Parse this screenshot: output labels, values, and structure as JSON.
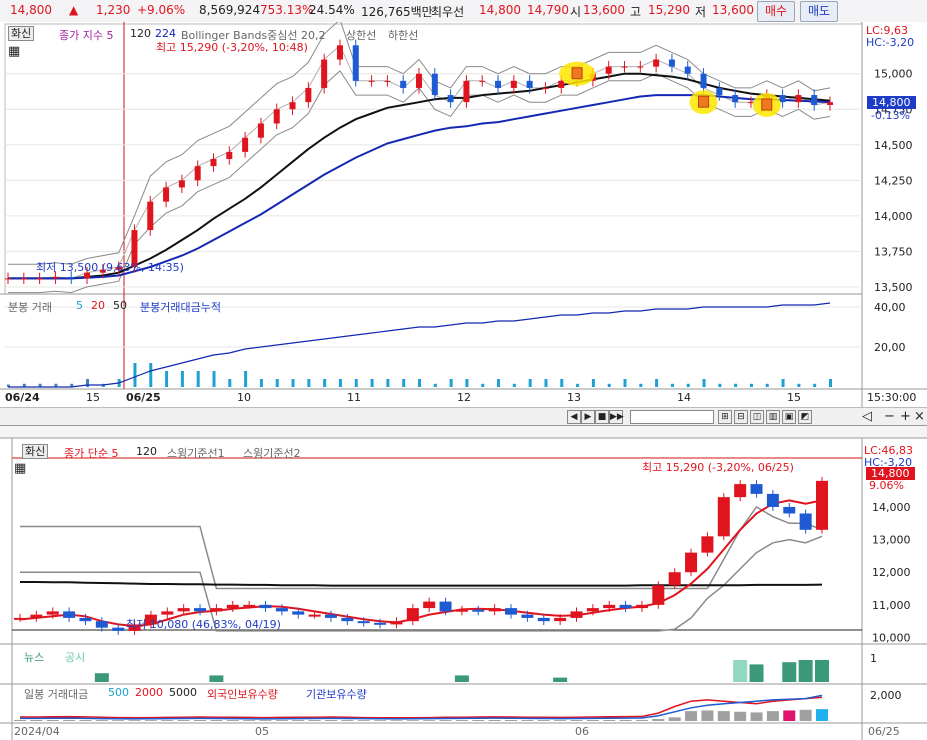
{
  "ticker": {
    "price": "14,800",
    "arrow": "▲",
    "change": "1,230",
    "change_pct": "+9.06%",
    "volume": "8,569,924",
    "vol_ratio": "753.13%",
    "turnover": "24.54%",
    "amount": "126,765백만",
    "quote_label": "최우선",
    "ask": "14,800",
    "bid": "14,790",
    "open_label": "시",
    "open": "13,600",
    "high_label": "고",
    "high": "15,290",
    "low_label": "저",
    "low": "13,600",
    "buy_label": "매수",
    "sell_label": "매도"
  },
  "top_chart": {
    "btn": "화신",
    "legend_main": "종가 지수 5",
    "legend_120": "120",
    "legend_224": "224",
    "legend_bb": "Bollinger Bands중심선 20,2",
    "legend_up": "상한선",
    "legend_down": "하한선",
    "hi_note": "최고 15,290 (-3,20%, 10:48)",
    "lo_note": "최저 13,500 (9,63%, 14:35)",
    "lc": "LC:9,63",
    "hc": "HC:-3,20",
    "price_box": "14,800",
    "price_pct": "-0.13%",
    "y_ticks": [
      "15,000",
      "14,750",
      "14,500",
      "14,250",
      "14,000",
      "13,750",
      "13,500"
    ],
    "vol_legend_a": "분봉 거래",
    "vol_legend_5": "5",
    "vol_legend_20": "20",
    "vol_legend_50": "50",
    "vol_legend_b": "분봉거래대금누적",
    "vol_ticks": [
      "40,00",
      "20,00"
    ],
    "x_labels": [
      "06/24",
      "15",
      "06/25",
      "10",
      "11",
      "12",
      "13",
      "14",
      "15",
      "15:30:00"
    ]
  },
  "bottom_chart": {
    "btn": "화신",
    "legend_main": "종가 단순 5",
    "legend_120": "120",
    "legend_sw1": "스윙기준선1",
    "legend_sw2": "스윙기준선2",
    "hi_note": "최고 15,290 (-3,20%, 06/25)",
    "lo_note": "최저 10,080 (46,83%, 04/19)",
    "lc": "LC:46,83",
    "hc": "HC:-3,20",
    "price_box": "14,800",
    "price_pct": "9.06%",
    "y_ticks": [
      "14,000",
      "13,000",
      "12,000",
      "11,000",
      "10,000"
    ],
    "news_legend_a": "뉴스",
    "news_legend_b": "공시",
    "news_tick": "1",
    "daily_legend": "일봉 거래대금",
    "daily_500": "500",
    "daily_2000": "2000",
    "daily_5000": "5000",
    "daily_foreign": "외국인보유수량",
    "daily_inst": "기관보유수량",
    "daily_tick": "2,000",
    "x_labels": [
      "2024/04",
      "05",
      "06",
      "06/25"
    ]
  },
  "colors": {
    "up": "#e0141e",
    "down": "#1e5ad2",
    "ma_black": "#111111",
    "ma_blue": "#1428b4",
    "bb_gray": "#8a8a8a",
    "highlight": "#ffe600"
  },
  "chart_data": [
    {
      "type": "candlestick",
      "title": "분봉",
      "ylim": [
        13450,
        15350
      ],
      "y_ticks": [
        15000,
        14750,
        14500,
        14250,
        14000,
        13750,
        13500
      ],
      "x_labels": [
        "06/24",
        "15",
        "06/25",
        "10",
        "11",
        "12",
        "13",
        "14",
        "15"
      ],
      "series": [
        {
          "name": "종가",
          "values": [
            13560,
            13560,
            13560,
            13570,
            13560,
            13600,
            13620,
            13640,
            13900,
            14100,
            14200,
            14250,
            14350,
            14400,
            14450,
            14550,
            14650,
            14750,
            14800,
            14900,
            15100,
            15200,
            14950,
            14950,
            14950,
            14900,
            15000,
            14850,
            14800,
            14950,
            14950,
            14900,
            14950,
            14900,
            14900,
            14950,
            14950,
            15000,
            15050,
            15050,
            15050,
            15100,
            15050,
            15000,
            14900,
            14850,
            14800,
            14800,
            14850,
            14800,
            14850,
            14780,
            14800
          ]
        },
        {
          "name": "120",
          "values": [
            13560,
            13560,
            13560,
            13560,
            13560,
            13570,
            13580,
            13600,
            13650,
            13700,
            13760,
            13830,
            13900,
            13980,
            14050,
            14120,
            14200,
            14290,
            14380,
            14470,
            14550,
            14620,
            14680,
            14720,
            14760,
            14780,
            14800,
            14820,
            14830,
            14830,
            14850,
            14860,
            14870,
            14880,
            14900,
            14920,
            14940,
            14960,
            14980,
            15000,
            15000,
            14990,
            14980,
            14960,
            14930,
            14900,
            14880,
            14860,
            14850,
            14840,
            14830,
            14820,
            14810
          ]
        },
        {
          "name": "224",
          "values": [
            13560,
            13560,
            13560,
            13560,
            13560,
            13565,
            13570,
            13580,
            13610,
            13640,
            13680,
            13720,
            13770,
            13830,
            13890,
            13950,
            14010,
            14080,
            14150,
            14220,
            14290,
            14350,
            14410,
            14460,
            14510,
            14540,
            14570,
            14600,
            14620,
            14630,
            14650,
            14660,
            14680,
            14700,
            14720,
            14740,
            14760,
            14780,
            14800,
            14820,
            14840,
            14850,
            14850,
            14850,
            14850,
            14840,
            14830,
            14820,
            14820,
            14815,
            14810,
            14805,
            14800
          ]
        }
      ]
    },
    {
      "type": "bar",
      "title": "분봉 거래",
      "ylim": [
        0,
        45
      ],
      "y_ticks": [
        40,
        20
      ],
      "series": [
        {
          "name": "분봉거래대금누적",
          "values": [
            0,
            0,
            0,
            0,
            0,
            1,
            1,
            2,
            5,
            8,
            10,
            12,
            14,
            16,
            17,
            19,
            20,
            21,
            22,
            23,
            24,
            25,
            26,
            27,
            28,
            29,
            30,
            30,
            31,
            32,
            32,
            33,
            33,
            34,
            35,
            36,
            36,
            37,
            37,
            38,
            38,
            39,
            39,
            39,
            40,
            40,
            40,
            40,
            40,
            41,
            41,
            41,
            42
          ]
        }
      ]
    },
    {
      "type": "candlestick",
      "title": "일봉",
      "ylim": [
        9800,
        15500
      ],
      "y_ticks": [
        14000,
        13000,
        12000,
        11000,
        10000
      ],
      "x_labels": [
        "2024/04",
        "05",
        "06",
        "06/25"
      ],
      "series": [
        {
          "name": "종가",
          "values": [
            10600,
            10700,
            10800,
            10600,
            10500,
            10300,
            10200,
            10400,
            10700,
            10800,
            10900,
            10800,
            10900,
            11000,
            11000,
            10900,
            10800,
            10700,
            10700,
            10600,
            10500,
            10450,
            10400,
            10500,
            10900,
            11100,
            10800,
            10850,
            10800,
            10900,
            10700,
            10600,
            10500,
            10600,
            10800,
            10900,
            11000,
            10900,
            11000,
            11600,
            12000,
            12600,
            13100,
            14300,
            14700,
            14400,
            14000,
            13800,
            13300,
            14800
          ]
        },
        {
          "name": "종가 단순 5",
          "values": [
            10550,
            10600,
            10650,
            10700,
            10650,
            10500,
            10400,
            10350,
            10400,
            10550,
            10700,
            10780,
            10820,
            10880,
            10920,
            10960,
            10940,
            10880,
            10800,
            10720,
            10640,
            10560,
            10500,
            10460,
            10560,
            10700,
            10780,
            10860,
            10880,
            10860,
            10820,
            10760,
            10700,
            10660,
            10680,
            10760,
            10840,
            10900,
            10950,
            11050,
            11300,
            11650,
            12100,
            12700,
            13300,
            13800,
            14100,
            14200,
            14100,
            14200
          ]
        },
        {
          "name": "120",
          "values": [
            11700,
            11700,
            11690,
            11690,
            11680,
            11670,
            11660,
            11650,
            11640,
            11640,
            11630,
            11630,
            11620,
            11620,
            11610,
            11610,
            11600,
            11600,
            11600,
            11590,
            11590,
            11590,
            11590,
            11590,
            11590,
            11590,
            11590,
            11590,
            11590,
            11590,
            11590,
            11590,
            11590,
            11590,
            11590,
            11590,
            11590,
            11590,
            11600,
            11600,
            11600,
            11600,
            11600,
            11600,
            11600,
            11610,
            11610,
            11610,
            11610,
            11620
          ]
        },
        {
          "name": "스윙기준선1",
          "values": [
            13400,
            13400,
            13400,
            13400,
            13400,
            13400,
            13400,
            13400,
            13400,
            13400,
            13400,
            13400,
            11500,
            11500,
            11500,
            11500,
            11500,
            11500,
            11500,
            11500,
            11500,
            11500,
            11500,
            11500,
            11500,
            11500,
            11500,
            11500,
            11500,
            11500,
            11500,
            11500,
            11500,
            11500,
            11500,
            11500,
            11500,
            11500,
            11500,
            11500,
            11500,
            11500,
            11500,
            12400,
            13300,
            14000,
            13700,
            13500,
            13500,
            13300
          ]
        },
        {
          "name": "스윙기준선2",
          "values": [
            12000,
            12000,
            12000,
            12000,
            12000,
            12000,
            12000,
            12000,
            12000,
            12000,
            12000,
            12000,
            10200,
            10200,
            10200,
            10200,
            10200,
            10200,
            10200,
            10200,
            10200,
            10200,
            10200,
            10200,
            10200,
            10200,
            10200,
            10200,
            10200,
            10200,
            10200,
            10200,
            10200,
            10200,
            10200,
            10200,
            10200,
            10200,
            10200,
            10200,
            10250,
            10600,
            11200,
            11600,
            12100,
            12600,
            12900,
            13000,
            12900,
            13100
          ]
        }
      ]
    },
    {
      "type": "bar",
      "title": "일봉 거래대금",
      "ylim": [
        0,
        2500
      ],
      "y_ticks": [
        2000
      ],
      "series": [
        {
          "name": "외국인보유수량",
          "values": [
            300,
            300,
            320,
            330,
            310,
            280,
            260,
            250,
            260,
            270,
            280,
            300,
            290,
            280,
            270,
            260,
            270,
            280,
            290,
            300,
            280,
            260,
            250,
            240,
            250,
            260,
            280,
            290,
            300,
            310,
            300,
            290,
            280,
            270,
            280,
            300,
            320,
            330,
            340,
            600,
            1100,
            1500,
            1600,
            1500,
            1400,
            1300,
            1500,
            1600,
            1700,
            1800
          ]
        },
        {
          "name": "기관보유수량",
          "values": [
            200,
            200,
            210,
            220,
            200,
            180,
            170,
            160,
            170,
            180,
            190,
            200,
            190,
            180,
            170,
            160,
            170,
            180,
            190,
            200,
            190,
            180,
            170,
            160,
            170,
            180,
            190,
            200,
            210,
            220,
            210,
            200,
            190,
            180,
            190,
            200,
            210,
            220,
            230,
            400,
            700,
            1000,
            1200,
            1300,
            1400,
            1500,
            1600,
            1650,
            1700,
            1950
          ]
        }
      ]
    }
  ]
}
